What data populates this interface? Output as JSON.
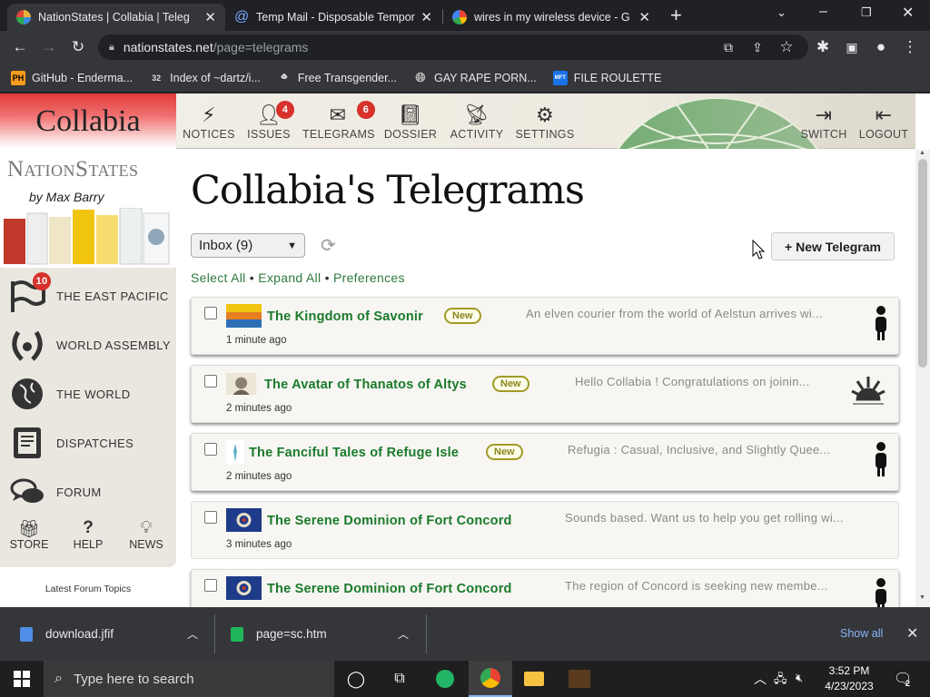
{
  "browser": {
    "tabs": [
      {
        "title": "NationStates | Collabia | Teleg",
        "active": true
      },
      {
        "title": "Temp Mail - Disposable Tempor",
        "active": false
      },
      {
        "title": "wires in my wireless device - G",
        "active": false
      }
    ],
    "new_tab_label": "+",
    "url_host": "nationstates.net",
    "url_path": "/page=telegrams",
    "bookmarks": [
      {
        "label": "GitHub - Enderma...",
        "icon": "PH"
      },
      {
        "label": "Index of ~dartz/i...",
        "icon": "32"
      },
      {
        "label": "Free Transgender...",
        "icon": "hat"
      },
      {
        "label": "GAY RAPE PORN...",
        "icon": "globe"
      },
      {
        "label": "FILE ROULETTE",
        "icon": "MFT"
      }
    ]
  },
  "site": {
    "nation_name": "Collabia",
    "nav": [
      {
        "label": "NOTICES",
        "icon": "bolt-icon"
      },
      {
        "label": "ISSUES",
        "icon": "person-icon",
        "badge": "4"
      },
      {
        "label": "TELEGRAMS",
        "icon": "envelope-icon",
        "badge": "6"
      },
      {
        "label": "DOSSIER",
        "icon": "book-icon"
      },
      {
        "label": "ACTIVITY",
        "icon": "satellite-icon"
      },
      {
        "label": "SETTINGS",
        "icon": "gears-icon"
      },
      {
        "label": "SWITCH",
        "icon": "login-icon"
      },
      {
        "label": "LOGOUT",
        "icon": "logout-icon"
      }
    ],
    "brand": "NationStates",
    "byline": "by Max Barry",
    "sidebar": [
      {
        "label": "THE EAST PACIFIC",
        "icon": "flag-icon",
        "badge": "10"
      },
      {
        "label": "WORLD ASSEMBLY",
        "icon": "wreath-icon"
      },
      {
        "label": "THE WORLD",
        "icon": "globe-icon"
      },
      {
        "label": "DISPATCHES",
        "icon": "document-icon"
      },
      {
        "label": "FORUM",
        "icon": "speech-icon"
      }
    ],
    "sidebar_small": [
      {
        "label": "STORE",
        "icon": "gift-icon"
      },
      {
        "label": "HELP",
        "icon": "question-icon"
      },
      {
        "label": "NEWS",
        "icon": "bulb-icon"
      }
    ],
    "latest_forum": "Latest Forum Topics"
  },
  "main": {
    "title": "Collabia's Telegrams",
    "box_select": "Inbox (9)",
    "new_telegram": "+ New Telegram",
    "links": [
      "Select All",
      "Expand All",
      "Preferences"
    ],
    "telegrams": [
      {
        "from": "The Kingdom of Savonir",
        "new": "New",
        "time": "1 minute ago",
        "preview": "An elven courier from the world of Aelstun arrives wi...",
        "flag": "savonir"
      },
      {
        "from": "The Avatar of Thanatos of Altys",
        "new": "New",
        "time": "2 minutes ago",
        "preview": "Hello Collabia ! Congratulations on joinin...",
        "flag": "altys"
      },
      {
        "from": "The Fanciful Tales of Refuge Isle",
        "new": "New",
        "time": "2 minutes ago",
        "preview": "Refugia : Casual, Inclusive, and Slightly Quee...",
        "flag": "refuge"
      },
      {
        "from": "The Serene Dominion of Fort Concord",
        "new": "",
        "time": "3 minutes ago",
        "preview": "Sounds based. Want us to help you get rolling wi...",
        "flag": "concord"
      },
      {
        "from": "The Serene Dominion of Fort Concord",
        "new": "",
        "time": "",
        "preview": "The region of Concord is seeking new membe...",
        "flag": "concord"
      }
    ]
  },
  "downloads": {
    "items": [
      "download.jfif",
      "page=sc.htm"
    ],
    "show_all": "Show all"
  },
  "taskbar": {
    "search_placeholder": "Type here to search",
    "time": "3:52 PM",
    "date": "4/23/2023",
    "notification_count": "2"
  },
  "colors": {
    "nav_green": "#1a7a2b",
    "link_green": "#2f7a3f",
    "badge_red": "#d6312b"
  }
}
